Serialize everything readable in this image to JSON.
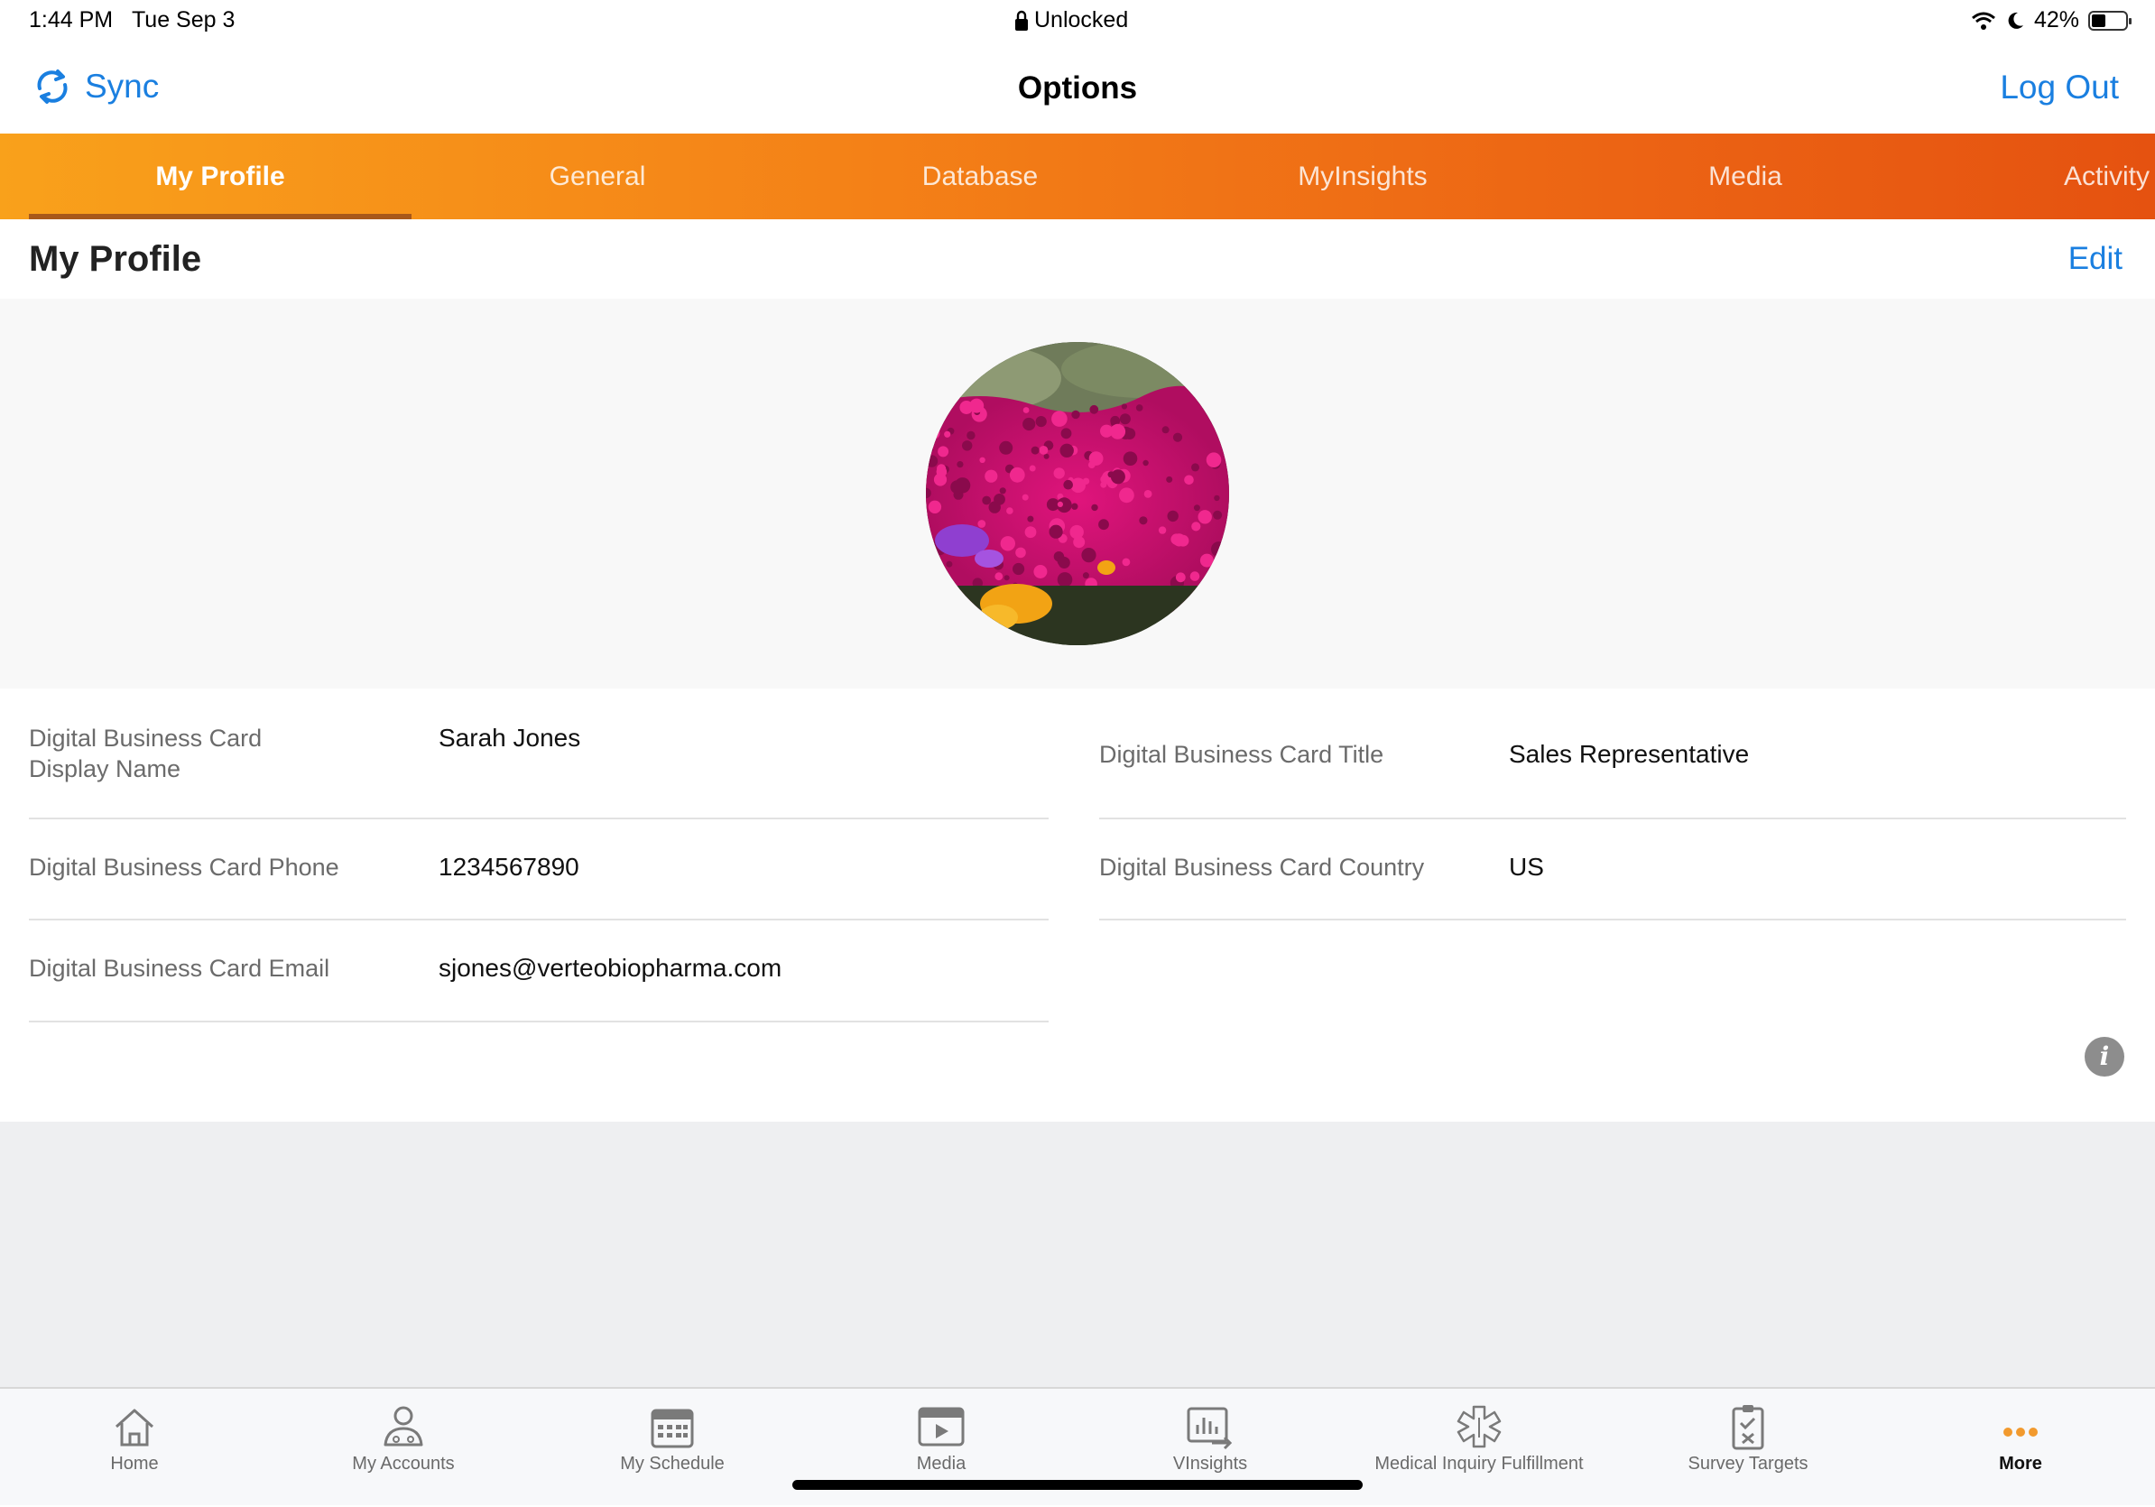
{
  "status": {
    "time": "1:44 PM",
    "date": "Tue Sep 3",
    "lock_text": "Unlocked",
    "battery": "42%",
    "battery_level": 0.42
  },
  "navbar": {
    "sync_label": "Sync",
    "title": "Options",
    "logout_label": "Log Out"
  },
  "tabs": [
    {
      "label": "My Profile",
      "active": true
    },
    {
      "label": "General",
      "active": false
    },
    {
      "label": "Database",
      "active": false
    },
    {
      "label": "MyInsights",
      "active": false
    },
    {
      "label": "Media",
      "active": false
    },
    {
      "label": "Activity",
      "active": false
    }
  ],
  "section": {
    "title": "My Profile",
    "edit_label": "Edit"
  },
  "fields": {
    "display_name": {
      "label_line1": "Digital Business Card",
      "label_line2": "Display Name",
      "value": "Sarah Jones"
    },
    "title": {
      "label": "Digital Business Card Title",
      "value": "Sales Representative"
    },
    "phone": {
      "label": "Digital Business Card Phone",
      "value": "1234567890"
    },
    "country": {
      "label": "Digital Business Card Country",
      "value": "US"
    },
    "email": {
      "label": "Digital Business Card Email",
      "value": "sjones@verteobiopharma.com"
    }
  },
  "bottom_tabs": [
    {
      "label": "Home",
      "icon": "home-icon"
    },
    {
      "label": "My Accounts",
      "icon": "accounts-icon"
    },
    {
      "label": "My Schedule",
      "icon": "calendar-icon"
    },
    {
      "label": "Media",
      "icon": "media-icon"
    },
    {
      "label": "VInsights",
      "icon": "insights-icon"
    },
    {
      "label": "Medical Inquiry Fulfillment",
      "icon": "medical-icon"
    },
    {
      "label": "Survey Targets",
      "icon": "survey-icon"
    },
    {
      "label": "More",
      "icon": "more-icon",
      "active": true
    }
  ],
  "colors": {
    "accent_blue": "#1a7fe0",
    "tab_orange_start": "#f9a11b",
    "tab_orange_end": "#e55210",
    "more_dots": "#f29a2e"
  }
}
